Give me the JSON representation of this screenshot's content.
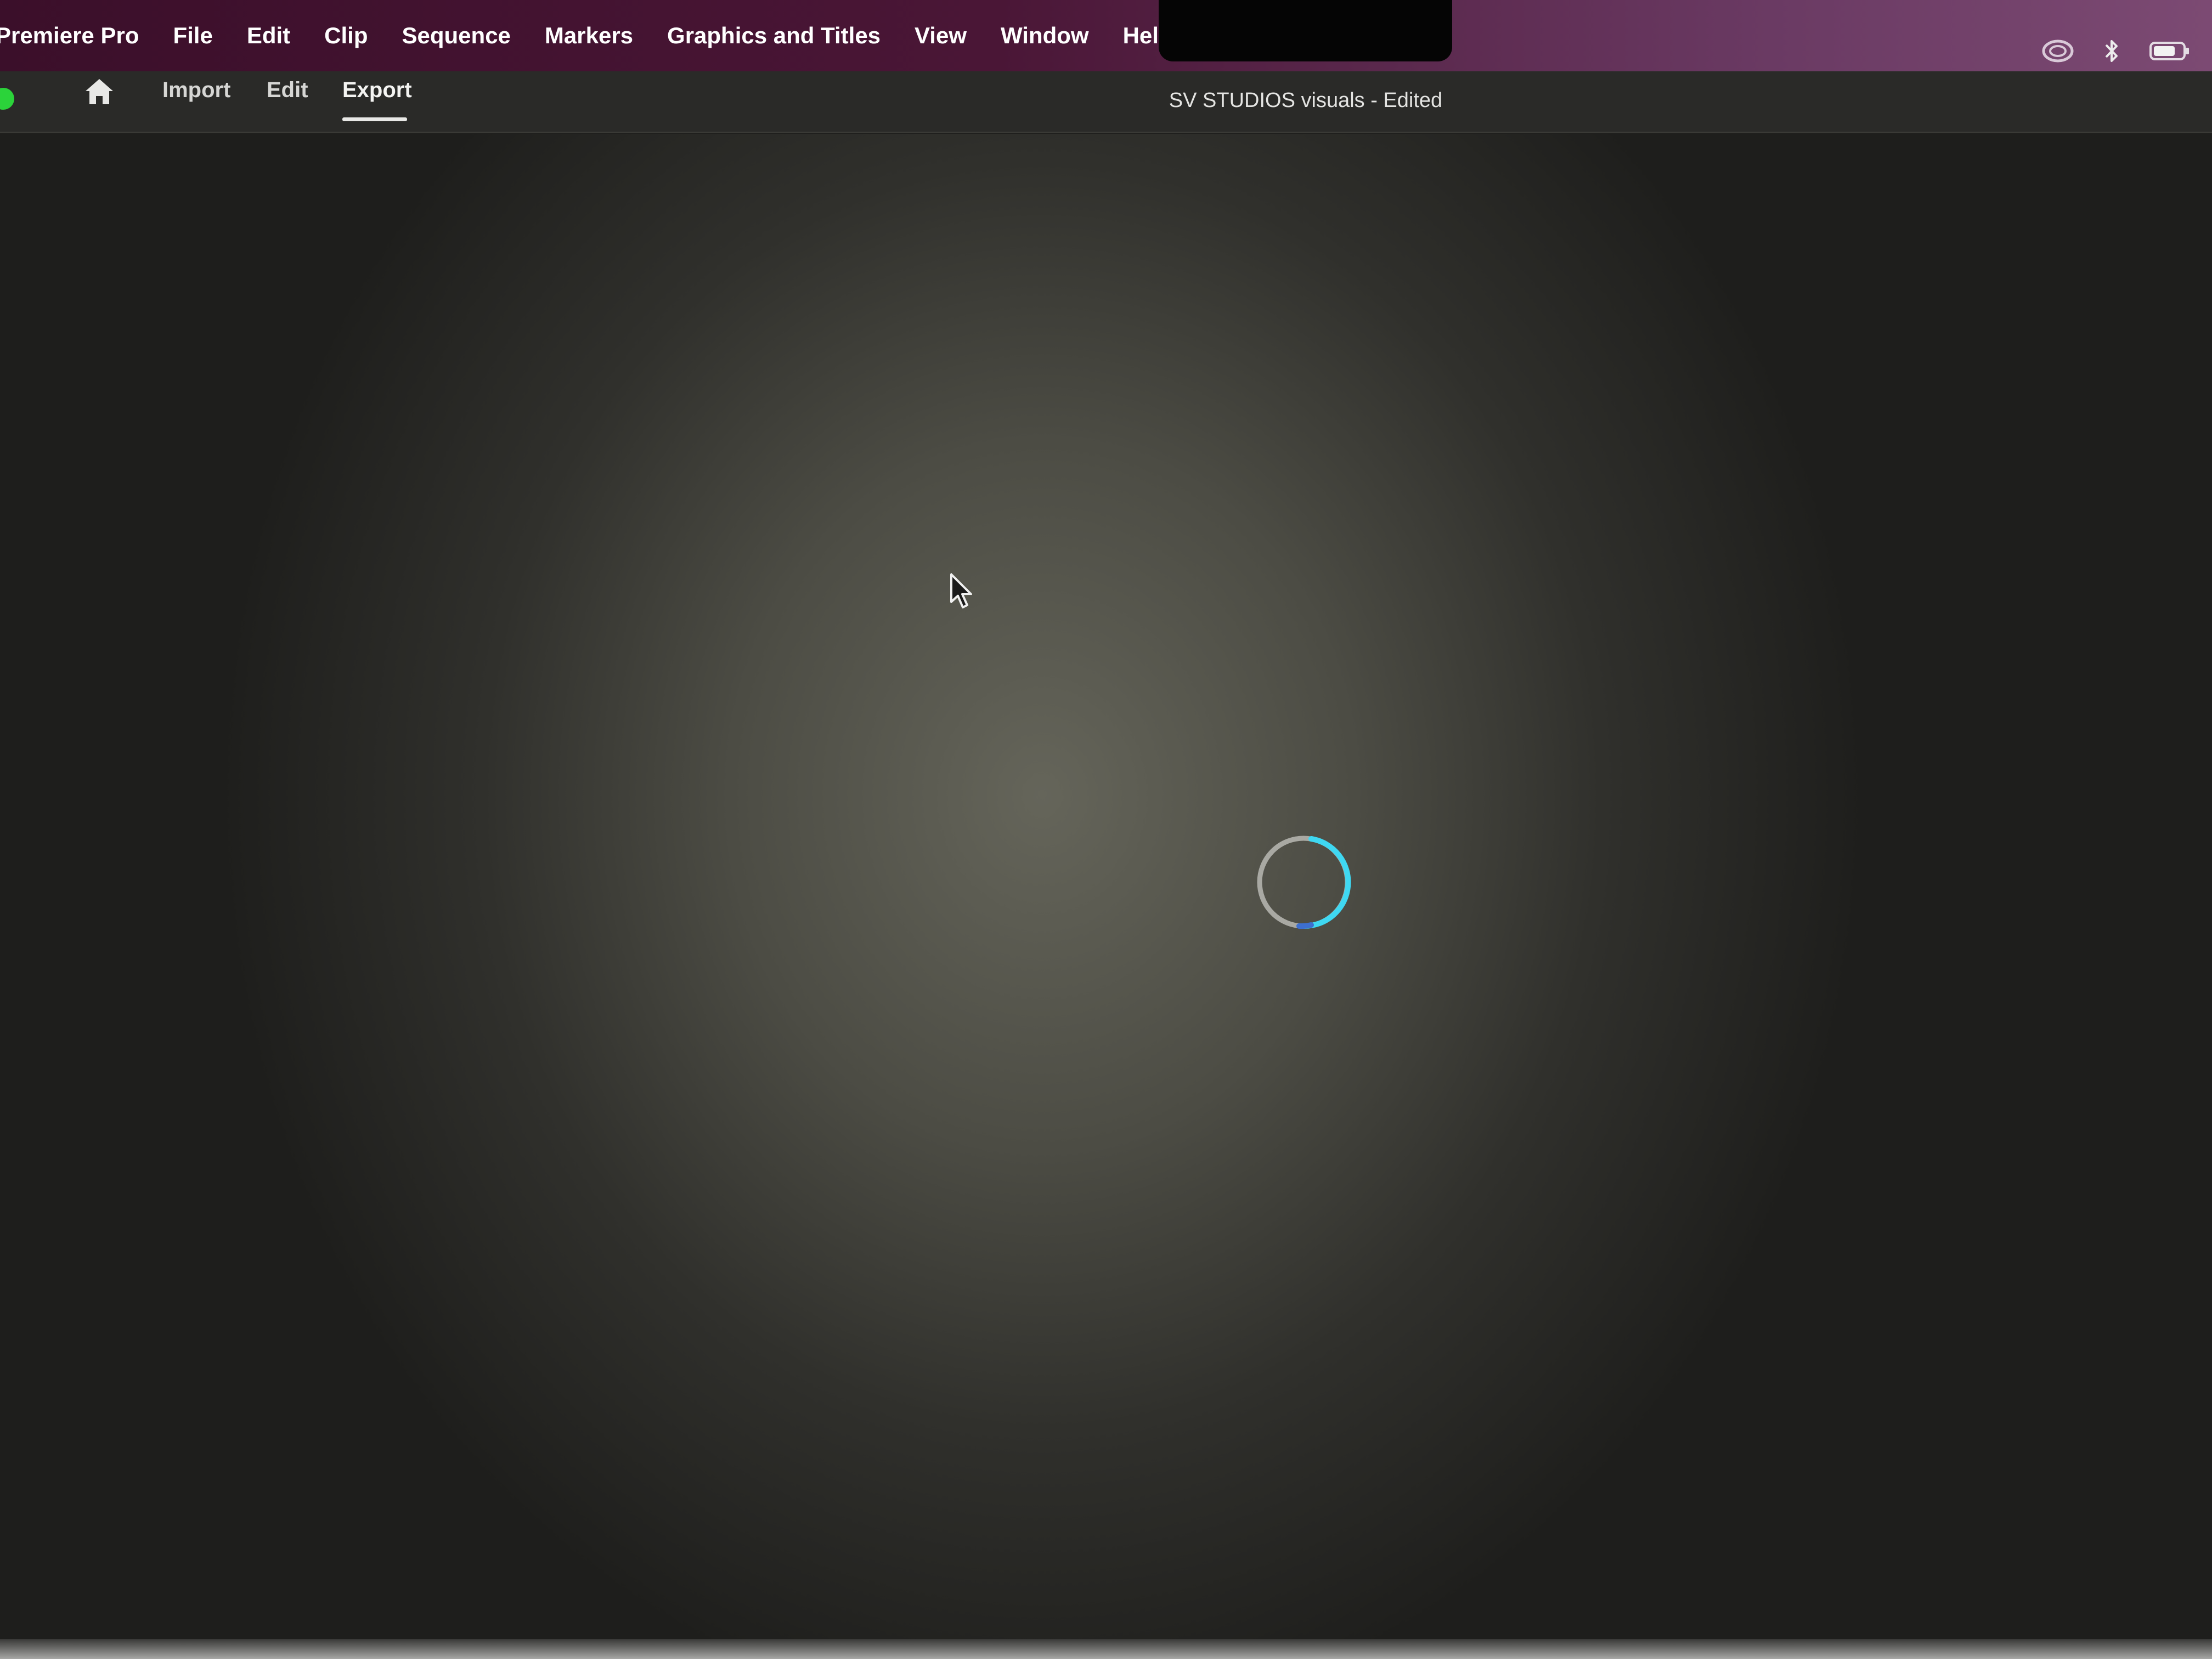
{
  "menubar": {
    "app_name": "Premiere Pro",
    "items": [
      "File",
      "Edit",
      "Clip",
      "Sequence",
      "Markers",
      "Graphics and Titles",
      "View",
      "Window",
      "Help"
    ],
    "status_icons": [
      "creative-cloud-icon",
      "bluetooth-icon",
      "battery-icon"
    ]
  },
  "header": {
    "tabs": [
      {
        "label": "Import",
        "active": false
      },
      {
        "label": "Edit",
        "active": false
      },
      {
        "label": "Export",
        "active": true
      }
    ],
    "document_title": "SV STUDIOS visuals - Edited"
  },
  "main": {
    "state": "loading",
    "spinner_icon": "loading-spinner-icon"
  },
  "colors": {
    "menubar": "#4a1636",
    "spinner_accent": "#3fd8f2",
    "traffic_light_green": "#2bd33a"
  }
}
